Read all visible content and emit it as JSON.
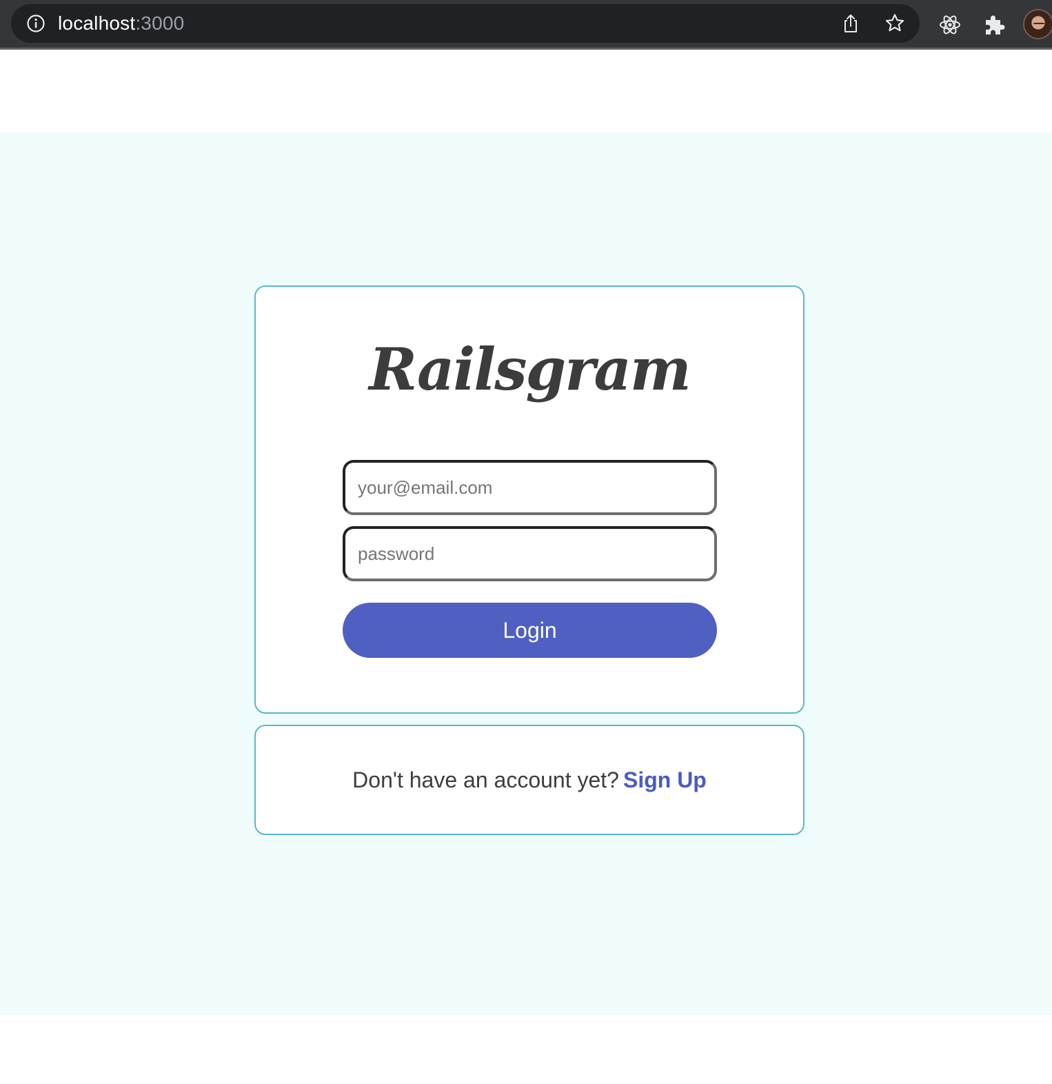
{
  "browser": {
    "url_host": "localhost",
    "url_port": ":3000"
  },
  "app": {
    "logo_text": "Railsgram"
  },
  "login_form": {
    "email_placeholder": "your@email.com",
    "email_value": "",
    "password_placeholder": "password",
    "password_value": "",
    "login_label": "Login"
  },
  "signup_prompt": {
    "text": "Don't have an account yet?",
    "link_label": "Sign Up"
  },
  "colors": {
    "accent": "#4f5fc2",
    "card_border": "#5ab6c8",
    "page_background": "#effcfb"
  }
}
